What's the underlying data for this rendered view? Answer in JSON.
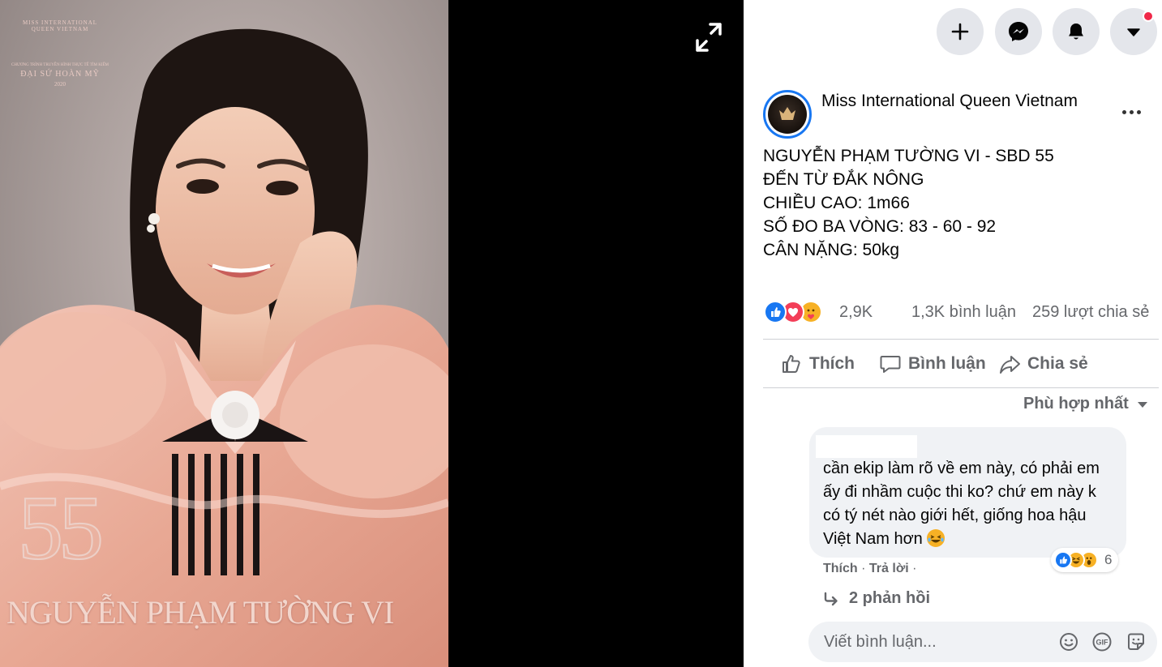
{
  "photo": {
    "brand_arc": "MISS INTERNATIONAL QUEEN VIETNAM",
    "brand_tagline": "CHƯƠNG TRÌNH TRUYỀN HÌNH THỰC TẾ TÌM KIẾM",
    "brand_name": "ĐẠI SỨ HOÀN MỸ",
    "brand_year": "2020",
    "sbd_number": "55",
    "caption_name": "NGUYỄN PHẠM TƯỜNG VI"
  },
  "header": {
    "buttons": [
      "create-icon",
      "messenger-icon",
      "notifications-icon",
      "account-menu-icon"
    ],
    "notification_dot_color": "#f02849"
  },
  "post": {
    "page_name": "Miss International Queen Vietnam",
    "text_lines": [
      "NGUYỄN PHẠM TƯỜNG VI - SBD 55",
      "ĐẾN TỪ ĐẮK NÔNG",
      "CHIỀU CAO: 1m66",
      "SỐ ĐO BA VÒNG: 83 - 60 - 92",
      "CÂN NẶNG: 50kg"
    ],
    "reactions": {
      "types": [
        "like",
        "love",
        "care"
      ],
      "count": "2,9K",
      "comments": "1,3K bình luận",
      "shares": "259 lượt chia sẻ"
    },
    "actions": {
      "like": "Thích",
      "comment": "Bình luận",
      "share": "Chia sẻ"
    },
    "sort_label": "Phù hợp nhất"
  },
  "comment": {
    "text": "cần ekip làm rõ về em này, có phải em ấy đi nhầm cuộc thi ko? chứ em này k có tý nét nào giới hết, giống hoa hậu Việt Nam hơn",
    "reaction_types": [
      "like",
      "haha",
      "wow"
    ],
    "reaction_count": "6",
    "like_label": "Thích",
    "reply_label": "Trả lời",
    "separator": "·",
    "replies_label": "2 phản hồi"
  },
  "composer": {
    "placeholder": "Viết bình luận...",
    "icons": [
      "emoji-icon",
      "gif-icon",
      "sticker-icon"
    ]
  },
  "colors": {
    "accent": "#1877f2",
    "muted_text": "#65676b",
    "bubble_bg": "#f0f2f5",
    "love": "#f33e58",
    "care": "#f7b125"
  }
}
